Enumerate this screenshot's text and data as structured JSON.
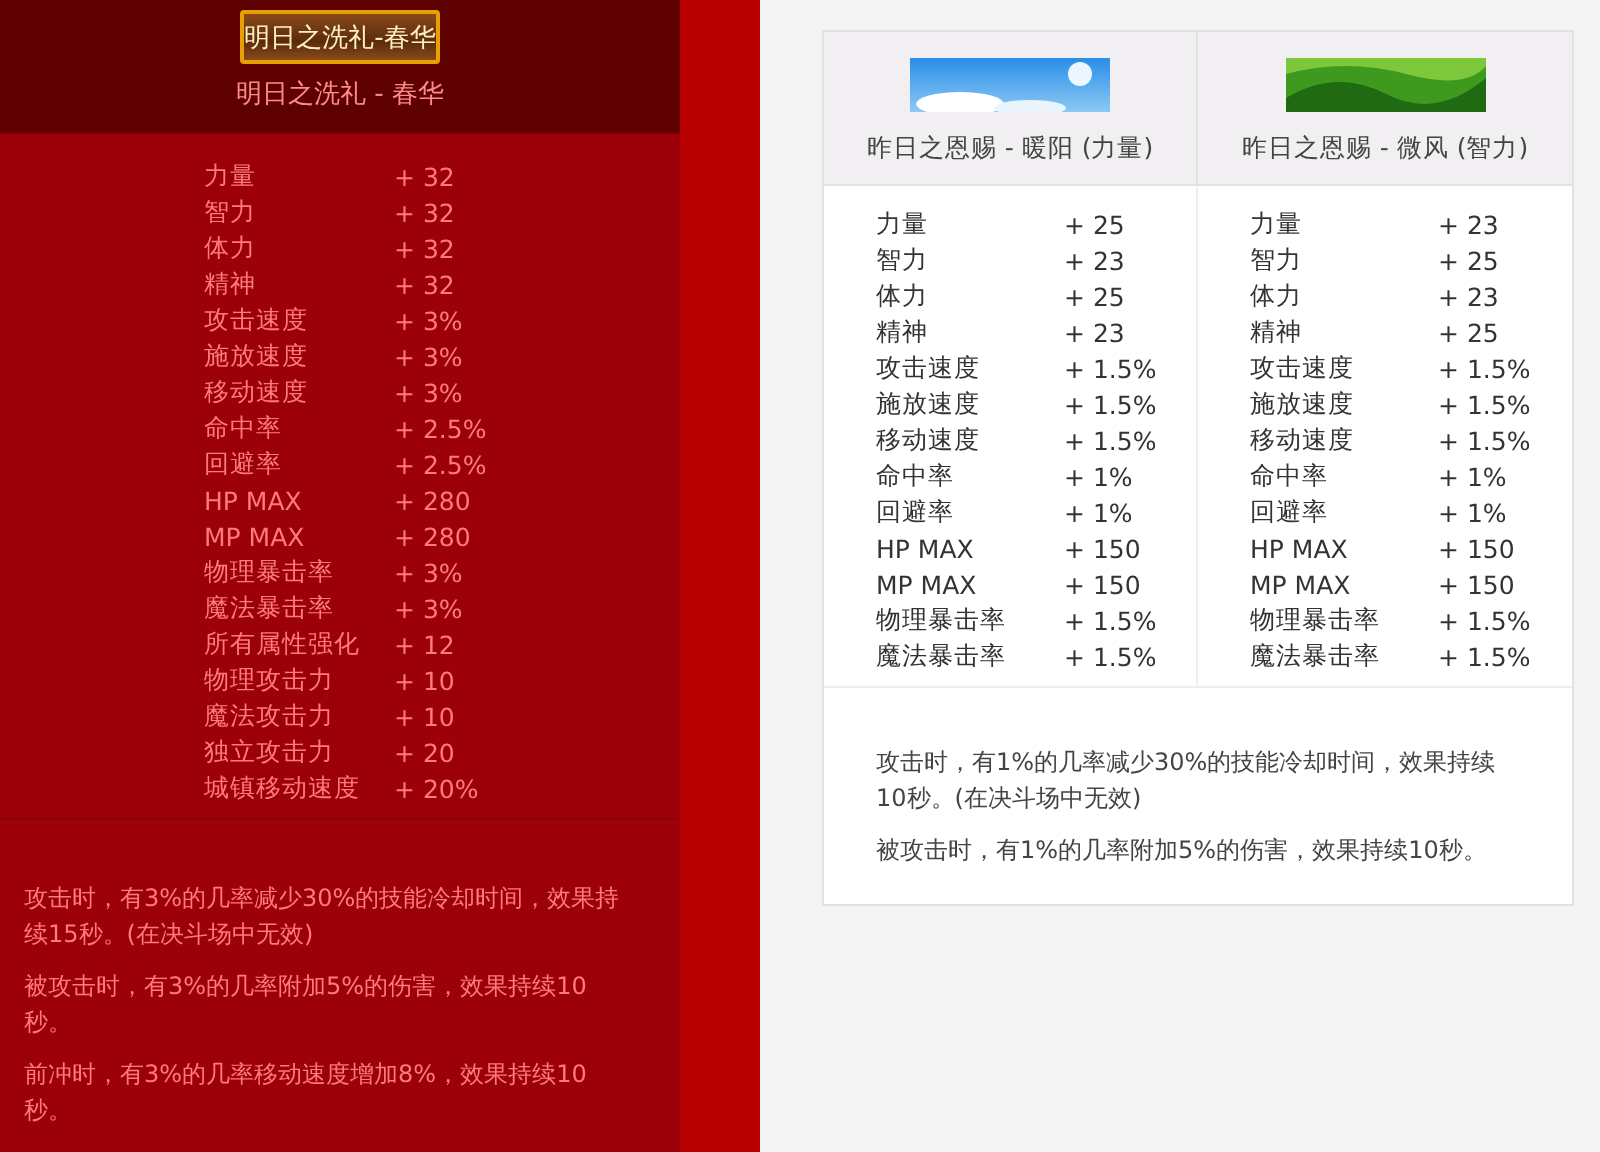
{
  "left": {
    "banner_text": "明日之洗礼-春华",
    "title": "明日之洗礼 - 春华",
    "stats": [
      {
        "name": "力量",
        "value": "+ 32"
      },
      {
        "name": "智力",
        "value": "+ 32"
      },
      {
        "name": "体力",
        "value": "+ 32"
      },
      {
        "name": "精神",
        "value": "+ 32"
      },
      {
        "name": "攻击速度",
        "value": "+ 3%"
      },
      {
        "name": "施放速度",
        "value": "+ 3%"
      },
      {
        "name": "移动速度",
        "value": "+ 3%"
      },
      {
        "name": "命中率",
        "value": "+ 2.5%"
      },
      {
        "name": "回避率",
        "value": "+ 2.5%"
      },
      {
        "name": "HP MAX",
        "value": "+ 280"
      },
      {
        "name": "MP MAX",
        "value": "+ 280"
      },
      {
        "name": "物理暴击率",
        "value": "+ 3%"
      },
      {
        "name": "魔法暴击率",
        "value": "+ 3%"
      },
      {
        "name": "所有属性强化",
        "value": "+ 12"
      },
      {
        "name": "物理攻击力",
        "value": "+ 10"
      },
      {
        "name": "魔法攻击力",
        "value": "+ 10"
      },
      {
        "name": "独立攻击力",
        "value": "+ 20"
      },
      {
        "name": "城镇移动速度",
        "value": "+ 20%"
      }
    ],
    "effects": [
      "攻击时，有3%的几率减少30%的技能冷却时间，效果持续15秒。(在决斗场中无效)",
      "被攻击时，有3%的几率附加5%的伤害，效果持续10秒。",
      "前冲时，有3%的几率移动速度增加8%，效果持续10秒。"
    ]
  },
  "right": {
    "options": [
      {
        "kind": "sky",
        "title": "昨日之恩赐 - 暖阳 (力量)",
        "stats": [
          {
            "name": "力量",
            "value": "+ 25"
          },
          {
            "name": "智力",
            "value": "+ 23"
          },
          {
            "name": "体力",
            "value": "+ 25"
          },
          {
            "name": "精神",
            "value": "+ 23"
          },
          {
            "name": "攻击速度",
            "value": "+ 1.5%"
          },
          {
            "name": "施放速度",
            "value": "+ 1.5%"
          },
          {
            "name": "移动速度",
            "value": "+ 1.5%"
          },
          {
            "name": "命中率",
            "value": "+ 1%"
          },
          {
            "name": "回避率",
            "value": "+ 1%"
          },
          {
            "name": "HP MAX",
            "value": "+ 150"
          },
          {
            "name": "MP MAX",
            "value": "+ 150"
          },
          {
            "name": "物理暴击率",
            "value": "+ 1.5%"
          },
          {
            "name": "魔法暴击率",
            "value": "+ 1.5%"
          }
        ]
      },
      {
        "kind": "grass",
        "title": "昨日之恩赐 - 微风 (智力)",
        "stats": [
          {
            "name": "力量",
            "value": "+ 23"
          },
          {
            "name": "智力",
            "value": "+ 25"
          },
          {
            "name": "体力",
            "value": "+ 23"
          },
          {
            "name": "精神",
            "value": "+ 25"
          },
          {
            "name": "攻击速度",
            "value": "+ 1.5%"
          },
          {
            "name": "施放速度",
            "value": "+ 1.5%"
          },
          {
            "name": "移动速度",
            "value": "+ 1.5%"
          },
          {
            "name": "命中率",
            "value": "+ 1%"
          },
          {
            "name": "回避率",
            "value": "+ 1%"
          },
          {
            "name": "HP MAX",
            "value": "+ 150"
          },
          {
            "name": "MP MAX",
            "value": "+ 150"
          },
          {
            "name": "物理暴击率",
            "value": "+ 1.5%"
          },
          {
            "name": "魔法暴击率",
            "value": "+ 1.5%"
          }
        ]
      }
    ],
    "effects": [
      "攻击时，有1%的几率减少30%的技能冷却时间，效果持续10秒。(在决斗场中无效)",
      "被攻击时，有1%的几率附加5%的伤害，效果持续10秒。"
    ]
  }
}
